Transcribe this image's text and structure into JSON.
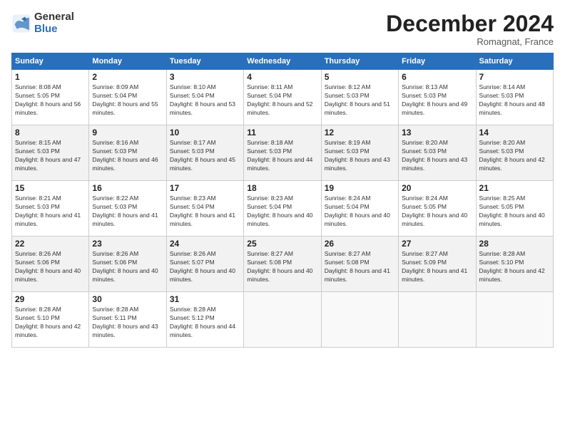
{
  "logo": {
    "general": "General",
    "blue": "Blue"
  },
  "title": "December 2024",
  "location": "Romagnat, France",
  "days_header": [
    "Sunday",
    "Monday",
    "Tuesday",
    "Wednesday",
    "Thursday",
    "Friday",
    "Saturday"
  ],
  "weeks": [
    [
      {
        "day": "1",
        "sunrise": "Sunrise: 8:08 AM",
        "sunset": "Sunset: 5:05 PM",
        "daylight": "Daylight: 8 hours and 56 minutes."
      },
      {
        "day": "2",
        "sunrise": "Sunrise: 8:09 AM",
        "sunset": "Sunset: 5:04 PM",
        "daylight": "Daylight: 8 hours and 55 minutes."
      },
      {
        "day": "3",
        "sunrise": "Sunrise: 8:10 AM",
        "sunset": "Sunset: 5:04 PM",
        "daylight": "Daylight: 8 hours and 53 minutes."
      },
      {
        "day": "4",
        "sunrise": "Sunrise: 8:11 AM",
        "sunset": "Sunset: 5:04 PM",
        "daylight": "Daylight: 8 hours and 52 minutes."
      },
      {
        "day": "5",
        "sunrise": "Sunrise: 8:12 AM",
        "sunset": "Sunset: 5:03 PM",
        "daylight": "Daylight: 8 hours and 51 minutes."
      },
      {
        "day": "6",
        "sunrise": "Sunrise: 8:13 AM",
        "sunset": "Sunset: 5:03 PM",
        "daylight": "Daylight: 8 hours and 49 minutes."
      },
      {
        "day": "7",
        "sunrise": "Sunrise: 8:14 AM",
        "sunset": "Sunset: 5:03 PM",
        "daylight": "Daylight: 8 hours and 48 minutes."
      }
    ],
    [
      {
        "day": "8",
        "sunrise": "Sunrise: 8:15 AM",
        "sunset": "Sunset: 5:03 PM",
        "daylight": "Daylight: 8 hours and 47 minutes."
      },
      {
        "day": "9",
        "sunrise": "Sunrise: 8:16 AM",
        "sunset": "Sunset: 5:03 PM",
        "daylight": "Daylight: 8 hours and 46 minutes."
      },
      {
        "day": "10",
        "sunrise": "Sunrise: 8:17 AM",
        "sunset": "Sunset: 5:03 PM",
        "daylight": "Daylight: 8 hours and 45 minutes."
      },
      {
        "day": "11",
        "sunrise": "Sunrise: 8:18 AM",
        "sunset": "Sunset: 5:03 PM",
        "daylight": "Daylight: 8 hours and 44 minutes."
      },
      {
        "day": "12",
        "sunrise": "Sunrise: 8:19 AM",
        "sunset": "Sunset: 5:03 PM",
        "daylight": "Daylight: 8 hours and 43 minutes."
      },
      {
        "day": "13",
        "sunrise": "Sunrise: 8:20 AM",
        "sunset": "Sunset: 5:03 PM",
        "daylight": "Daylight: 8 hours and 43 minutes."
      },
      {
        "day": "14",
        "sunrise": "Sunrise: 8:20 AM",
        "sunset": "Sunset: 5:03 PM",
        "daylight": "Daylight: 8 hours and 42 minutes."
      }
    ],
    [
      {
        "day": "15",
        "sunrise": "Sunrise: 8:21 AM",
        "sunset": "Sunset: 5:03 PM",
        "daylight": "Daylight: 8 hours and 41 minutes."
      },
      {
        "day": "16",
        "sunrise": "Sunrise: 8:22 AM",
        "sunset": "Sunset: 5:03 PM",
        "daylight": "Daylight: 8 hours and 41 minutes."
      },
      {
        "day": "17",
        "sunrise": "Sunrise: 8:23 AM",
        "sunset": "Sunset: 5:04 PM",
        "daylight": "Daylight: 8 hours and 41 minutes."
      },
      {
        "day": "18",
        "sunrise": "Sunrise: 8:23 AM",
        "sunset": "Sunset: 5:04 PM",
        "daylight": "Daylight: 8 hours and 40 minutes."
      },
      {
        "day": "19",
        "sunrise": "Sunrise: 8:24 AM",
        "sunset": "Sunset: 5:04 PM",
        "daylight": "Daylight: 8 hours and 40 minutes."
      },
      {
        "day": "20",
        "sunrise": "Sunrise: 8:24 AM",
        "sunset": "Sunset: 5:05 PM",
        "daylight": "Daylight: 8 hours and 40 minutes."
      },
      {
        "day": "21",
        "sunrise": "Sunrise: 8:25 AM",
        "sunset": "Sunset: 5:05 PM",
        "daylight": "Daylight: 8 hours and 40 minutes."
      }
    ],
    [
      {
        "day": "22",
        "sunrise": "Sunrise: 8:26 AM",
        "sunset": "Sunset: 5:06 PM",
        "daylight": "Daylight: 8 hours and 40 minutes."
      },
      {
        "day": "23",
        "sunrise": "Sunrise: 8:26 AM",
        "sunset": "Sunset: 5:06 PM",
        "daylight": "Daylight: 8 hours and 40 minutes."
      },
      {
        "day": "24",
        "sunrise": "Sunrise: 8:26 AM",
        "sunset": "Sunset: 5:07 PM",
        "daylight": "Daylight: 8 hours and 40 minutes."
      },
      {
        "day": "25",
        "sunrise": "Sunrise: 8:27 AM",
        "sunset": "Sunset: 5:08 PM",
        "daylight": "Daylight: 8 hours and 40 minutes."
      },
      {
        "day": "26",
        "sunrise": "Sunrise: 8:27 AM",
        "sunset": "Sunset: 5:08 PM",
        "daylight": "Daylight: 8 hours and 41 minutes."
      },
      {
        "day": "27",
        "sunrise": "Sunrise: 8:27 AM",
        "sunset": "Sunset: 5:09 PM",
        "daylight": "Daylight: 8 hours and 41 minutes."
      },
      {
        "day": "28",
        "sunrise": "Sunrise: 8:28 AM",
        "sunset": "Sunset: 5:10 PM",
        "daylight": "Daylight: 8 hours and 42 minutes."
      }
    ],
    [
      {
        "day": "29",
        "sunrise": "Sunrise: 8:28 AM",
        "sunset": "Sunset: 5:10 PM",
        "daylight": "Daylight: 8 hours and 42 minutes."
      },
      {
        "day": "30",
        "sunrise": "Sunrise: 8:28 AM",
        "sunset": "Sunset: 5:11 PM",
        "daylight": "Daylight: 8 hours and 43 minutes."
      },
      {
        "day": "31",
        "sunrise": "Sunrise: 8:28 AM",
        "sunset": "Sunset: 5:12 PM",
        "daylight": "Daylight: 8 hours and 44 minutes."
      },
      null,
      null,
      null,
      null
    ]
  ]
}
